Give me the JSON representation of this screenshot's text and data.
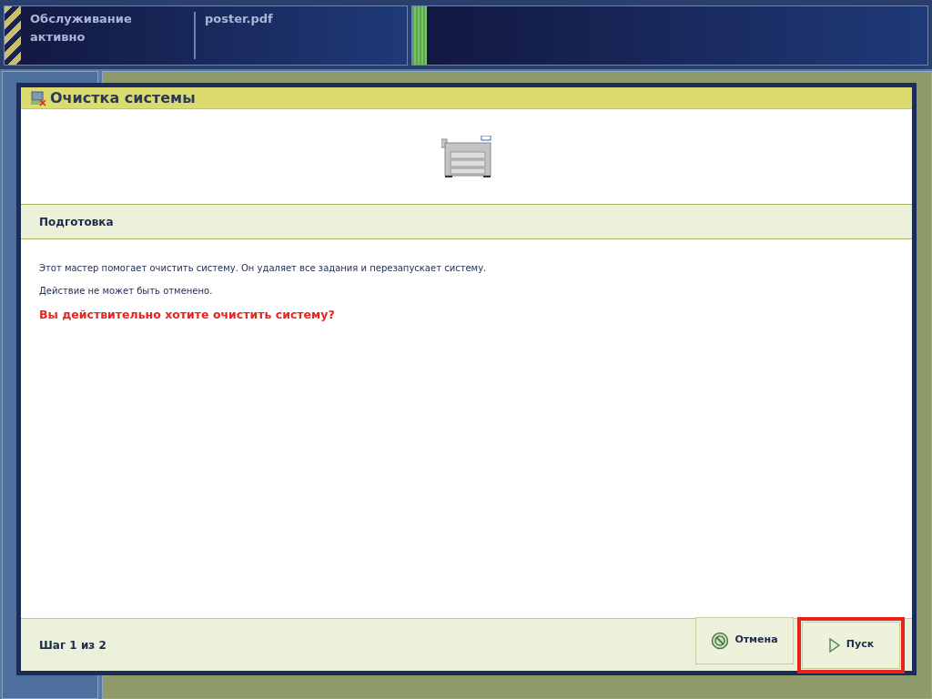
{
  "status_bar": {
    "status": "Обслуживание активно",
    "file": "poster.pdf"
  },
  "dialog": {
    "title": "Очистка системы",
    "section": "Подготовка",
    "messages": [
      {
        "kind": "info",
        "text": "Этот мастер помогает очистить систему. Он удаляет все задания и перезапускает систему."
      },
      {
        "kind": "info",
        "text": "Действие не может быть отменено."
      },
      {
        "kind": "warning",
        "text": "Вы действительно хотите очистить систему?"
      }
    ],
    "step": "Шаг 1 из 2",
    "buttons": [
      {
        "kind": "cancel",
        "label": "Отмена",
        "highlighted": false
      },
      {
        "kind": "start",
        "label": "Пуск",
        "highlighted": true
      }
    ]
  }
}
